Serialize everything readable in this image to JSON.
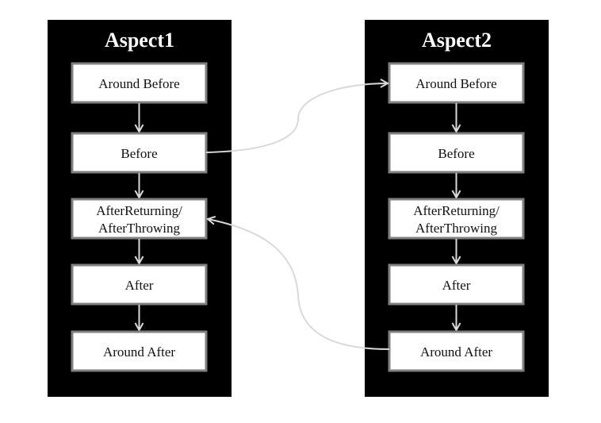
{
  "aspects": [
    {
      "title": "Aspect1",
      "steps": [
        "Around Before",
        "Before",
        "AfterReturning/\nAfterThrowing",
        "After",
        "Around After"
      ]
    },
    {
      "title": "Aspect2",
      "steps": [
        "Around Before",
        "Before",
        "AfterReturning/\nAfterThrowing",
        "After",
        "Around After"
      ]
    }
  ],
  "connectors": [
    {
      "from": "Aspect1.Before",
      "to": "Aspect2.Around Before"
    },
    {
      "from": "Aspect2.Around After",
      "to": "Aspect1.AfterReturning/AfterThrowing"
    }
  ],
  "colors": {
    "panel": "#000000",
    "box_border": "#808080",
    "arrow": "#d9d9d9"
  }
}
